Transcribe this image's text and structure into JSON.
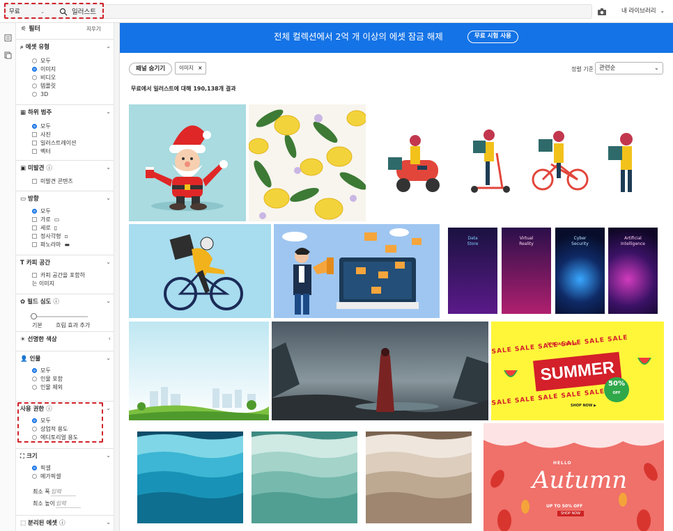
{
  "topbar": {
    "filter_dropdown": "무료",
    "search_query": "일러스트",
    "my_library": "내 라이브러리"
  },
  "sidebar": {
    "title": "필터",
    "clear": "지우기",
    "sections": {
      "asset_type": {
        "title": "에셋 유형",
        "options": [
          "모두",
          "이미지",
          "비디오",
          "템플릿",
          "3D"
        ],
        "selected": 1
      },
      "subcategory": {
        "title": "하위 범주",
        "options": [
          "모두",
          "사진",
          "일러스트레이션",
          "벡터"
        ],
        "selected": 0
      },
      "undiscovered": {
        "title": "미발견",
        "options": [
          "미발견 콘텐츠"
        ]
      },
      "orientation": {
        "title": "방향",
        "options": [
          "모두",
          "가로",
          "세로",
          "정사각형",
          "파노라마"
        ],
        "selected": 0
      },
      "copy_space": {
        "title": "카피 공간",
        "options": [
          "카피 공간을 포함하",
          "는 이미지"
        ]
      },
      "depth_of_field": {
        "title": "필드 심도",
        "min_label": "기본",
        "max_label": "흐림 효과 추가"
      },
      "vivid_colors": {
        "title": "선명한 색상"
      },
      "people": {
        "title": "인물",
        "options": [
          "모두",
          "인물 포함",
          "인물 제외"
        ],
        "selected": 0
      },
      "usage_rights": {
        "title": "사용 권한",
        "options": [
          "모두",
          "상업적 용도",
          "에디토리얼 용도"
        ],
        "selected": 0
      },
      "size": {
        "title": "크기",
        "options": [
          "픽셀",
          "메가픽셀"
        ],
        "selected": 0,
        "min_width_label": "최소 폭",
        "min_height_label": "최소 높이",
        "input_placeholder": "입력"
      },
      "isolated": {
        "title": "분리된 에셋"
      }
    }
  },
  "banner": {
    "text": "전체 컬렉션에서 2억 개 이상의 에셋 잠금 해제",
    "button": "무료 시험 사용"
  },
  "toolbar": {
    "hide_panel": "패널 숨기기",
    "chip": "이미지",
    "chip_close": "×",
    "sort_label": "정렬 기준",
    "sort_value": "관련순"
  },
  "results": {
    "text": "무료에서 일러스트에 대해 190,138개 결과"
  },
  "thumbnails": {
    "data_store": "Data\nStore",
    "virtual_reality": "Virtual\nReality",
    "cyber_security": "Cyber\nSecurity",
    "artificial_intelligence": "Artificial\nIntelligence",
    "sale": "SALE",
    "summer": "SUMMER",
    "special_offer": "SPECIAL OFFER",
    "fifty_off": "50%",
    "off": "OFF",
    "shop_now": "SHOP NOW ▶",
    "hello": "HELLO",
    "autumn": "Autumn",
    "autumn_offer": "UP TO 50% OFF",
    "autumn_shop": "SHOP NOW"
  },
  "colors": {
    "accent": "#1473e6",
    "highlight": "#d0212a"
  }
}
